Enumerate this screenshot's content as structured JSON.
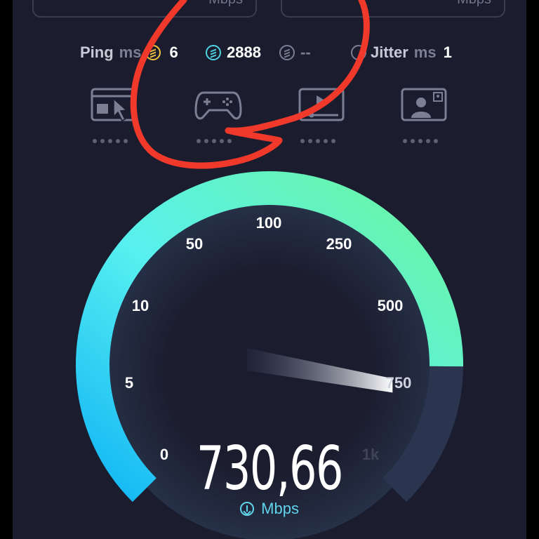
{
  "top_cards": {
    "left_unit": "Mbps",
    "right_unit": "Mbps"
  },
  "stats": {
    "ping_label": "Ping",
    "ping_unit": "ms",
    "ping_value": "6",
    "download_ping_value": "2888",
    "upload_ping_value": "--",
    "jitter_label": "Jitter",
    "jitter_unit": "ms",
    "jitter_value": "1"
  },
  "activities": [
    {
      "icon": "web-browsing-icon"
    },
    {
      "icon": "gaming-controller-icon"
    },
    {
      "icon": "video-streaming-icon"
    },
    {
      "icon": "video-call-icon"
    }
  ],
  "gauge": {
    "scale_labels": [
      "0",
      "5",
      "10",
      "50",
      "100",
      "250",
      "500",
      "750",
      "1k"
    ],
    "reading": "730,66",
    "unit": "Mbps",
    "fill_fraction": 0.93,
    "colors": {
      "arc_start": "#12b5f5",
      "arc_mid": "#57f0f0",
      "arc_end": "#6cf59e",
      "arc_empty": "#2b3550",
      "annotation": "#f0392b"
    }
  }
}
